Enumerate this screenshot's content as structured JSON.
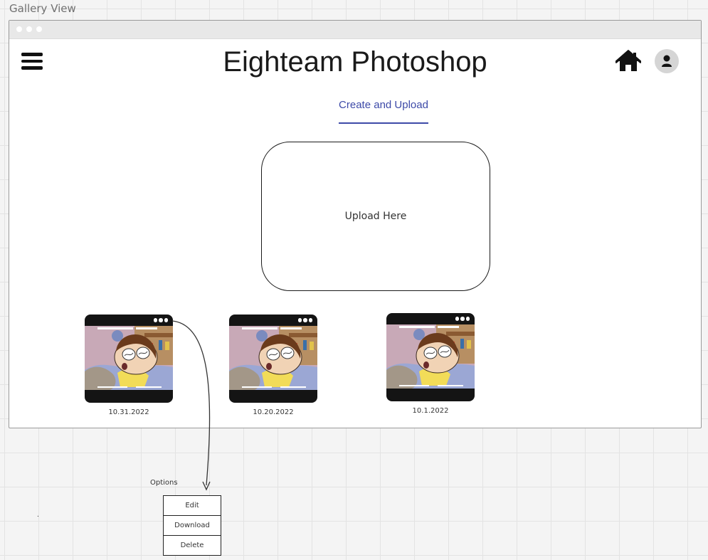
{
  "board": {
    "title": "Gallery View"
  },
  "app": {
    "title": "Eighteam Photoshop"
  },
  "icons": {
    "menu": "hamburger-menu-icon",
    "home": "home-icon",
    "profile": "user-icon",
    "more": "more-options-icon"
  },
  "colors": {
    "accent": "#3d4aa8",
    "thumbnail_frame": "#141414"
  },
  "tabs": [
    {
      "label": "Create and Upload",
      "active": true
    }
  ],
  "upload": {
    "label": "Upload Here"
  },
  "gallery": {
    "items": [
      {
        "date": "10.31.2022"
      },
      {
        "date": "10.20.2022"
      },
      {
        "date": "10.1.2022"
      }
    ]
  },
  "options": {
    "label": "Options",
    "items": [
      "Edit",
      "Download",
      "Delete"
    ]
  },
  "stray_mark": "."
}
